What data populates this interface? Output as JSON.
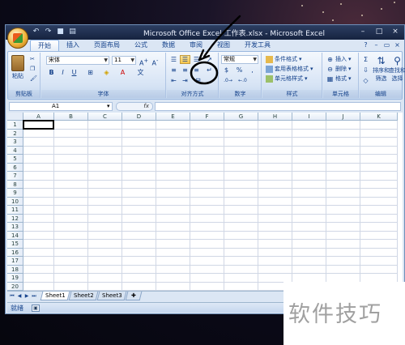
{
  "window": {
    "title": "Microsoft Office Excel 工作表.xlsx - Microsoft Excel"
  },
  "tabs": [
    {
      "label": "开始",
      "active": true
    },
    {
      "label": "插入"
    },
    {
      "label": "页面布局"
    },
    {
      "label": "公式"
    },
    {
      "label": "数据"
    },
    {
      "label": "审阅"
    },
    {
      "label": "视图"
    },
    {
      "label": "开发工具"
    }
  ],
  "ribbon": {
    "clipboard": {
      "label": "剪贴板",
      "paste": "粘贴"
    },
    "font": {
      "label": "字体",
      "name": "宋体",
      "size": "11",
      "bold": "B",
      "italic": "I",
      "underline": "U"
    },
    "alignment": {
      "label": "对齐方式"
    },
    "number": {
      "label": "数字",
      "format": "常规",
      "percent": "%",
      "comma": ","
    },
    "styles": {
      "label": "样式",
      "conditional": "条件格式",
      "table": "套用表格格式",
      "cell": "单元格样式"
    },
    "cells": {
      "label": "单元格",
      "insert": "插入",
      "delete": "删除",
      "format": "格式"
    },
    "editing": {
      "label": "编辑",
      "sort": "排序和",
      "sort2": "筛选",
      "find": "查找和",
      "find2": "选择"
    }
  },
  "formula_bar": {
    "name_box": "A1",
    "fx": "fx",
    "value": ""
  },
  "columns": [
    "A",
    "B",
    "C",
    "D",
    "E",
    "F",
    "G",
    "H",
    "I",
    "J",
    "K"
  ],
  "rows": [
    "1",
    "2",
    "3",
    "4",
    "5",
    "6",
    "7",
    "8",
    "9",
    "10",
    "11",
    "12",
    "13",
    "14",
    "15",
    "16",
    "17",
    "18",
    "19",
    "20"
  ],
  "sheets": [
    {
      "label": "Sheet1",
      "active": true
    },
    {
      "label": "Sheet2"
    },
    {
      "label": "Sheet3"
    }
  ],
  "status": {
    "text": "就绪"
  },
  "watermark": "软件技巧",
  "colors": {
    "accent": "#15428b",
    "ribbon": "#dbe6f4",
    "titlebar": "#1f2f52"
  }
}
